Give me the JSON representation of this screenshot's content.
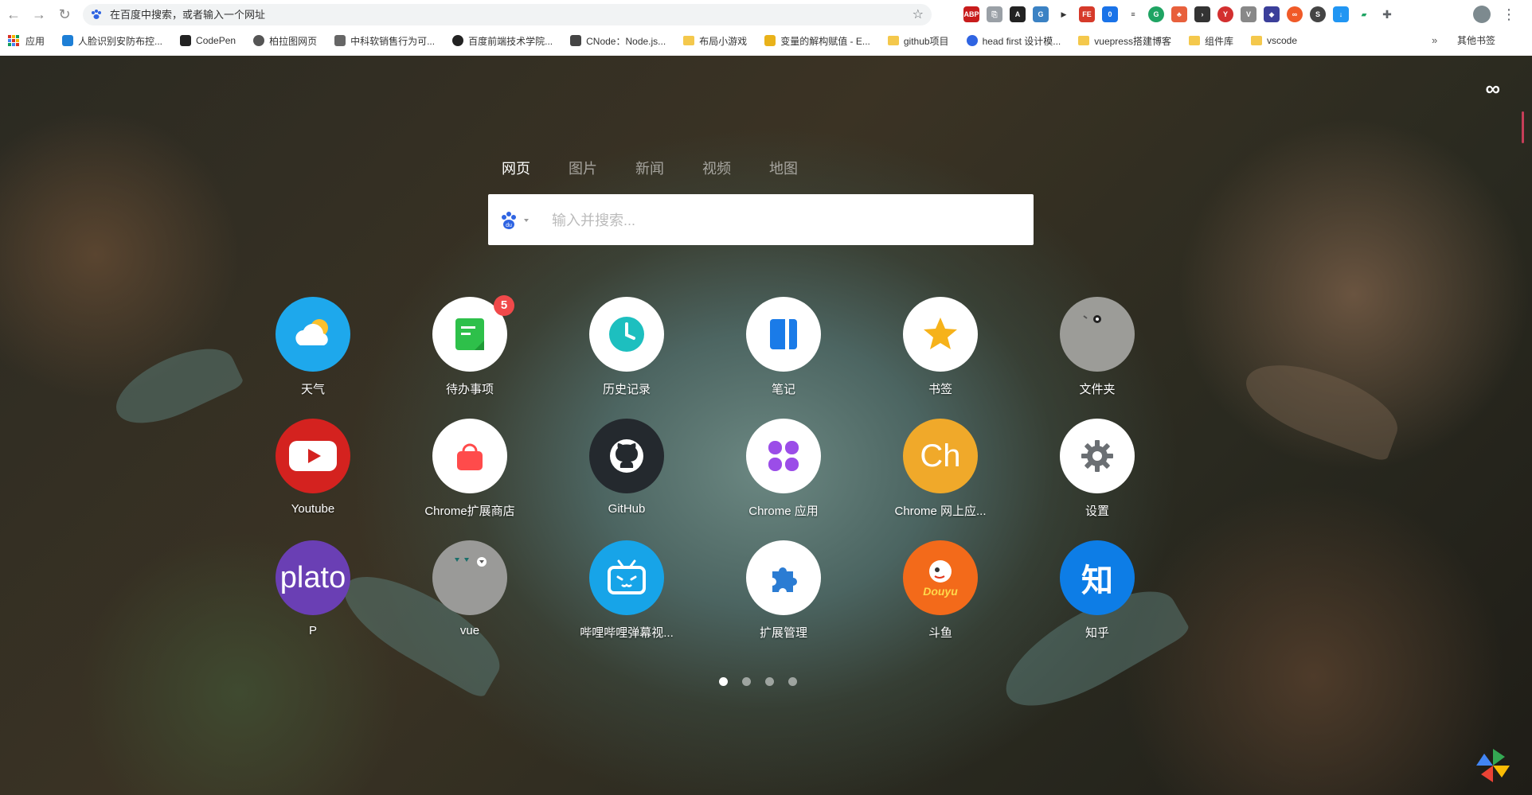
{
  "browser": {
    "omnibox_text": "在百度中搜索，或者输入一个网址",
    "bookmarks": [
      {
        "label": "应用",
        "icon": "apps-icon"
      },
      {
        "label": "人脸识别安防布控...",
        "icon": "edge-icon"
      },
      {
        "label": "CodePen",
        "icon": "codepen-icon"
      },
      {
        "label": "柏拉图网页",
        "icon": "globe-icon"
      },
      {
        "label": "中科软销售行为可...",
        "icon": "page-icon"
      },
      {
        "label": "百度前端技术学院...",
        "icon": "baidu-fe-icon"
      },
      {
        "label": "CNode：Node.js...",
        "icon": "cnode-icon"
      },
      {
        "label": "布局小游戏",
        "icon": "folder-icon"
      },
      {
        "label": "变量的解构赋值 - E...",
        "icon": "es-icon"
      },
      {
        "label": "github项目",
        "icon": "folder-icon"
      },
      {
        "label": "head first 设计模...",
        "icon": "paw-icon"
      },
      {
        "label": "vuepress搭建博客",
        "icon": "folder-icon"
      },
      {
        "label": "组件库",
        "icon": "folder-icon"
      },
      {
        "label": "vscode",
        "icon": "folder-icon"
      }
    ],
    "more": "»",
    "other_bookmarks": "其他书签"
  },
  "newtab": {
    "tabs": [
      "网页",
      "图片",
      "新闻",
      "视频",
      "地图"
    ],
    "active_tab": 0,
    "search_placeholder": "输入并搜索...",
    "engine": "baidu-icon",
    "apps": [
      {
        "label": "天气",
        "icon": "weather-icon",
        "bg": "#1ea8ec"
      },
      {
        "label": "待办事项",
        "icon": "todo-icon",
        "bg": "#ffffff",
        "badge": "5"
      },
      {
        "label": "历史记录",
        "icon": "history-icon",
        "bg": "#ffffff"
      },
      {
        "label": "笔记",
        "icon": "notes-icon",
        "bg": "#ffffff"
      },
      {
        "label": "书签",
        "icon": "bookmark-star-icon",
        "bg": "#ffffff"
      },
      {
        "label": "文件夹",
        "icon": "folder-icon",
        "bg": "#9c9c98"
      },
      {
        "label": "Youtube",
        "icon": "youtube-icon",
        "bg": "#d4221f"
      },
      {
        "label": "Chrome扩展商店",
        "icon": "chrome-store-icon",
        "bg": "#ffffff"
      },
      {
        "label": "GitHub",
        "icon": "github-icon",
        "bg": "#24292e"
      },
      {
        "label": "Chrome 应用",
        "icon": "chrome-apps-icon",
        "bg": "#ffffff"
      },
      {
        "label": "Chrome 网上应...",
        "icon": "chrome-webstore-icon",
        "bg": "#f0a92a",
        "text": "Ch"
      },
      {
        "label": "设置",
        "icon": "settings-icon",
        "bg": "#ffffff"
      },
      {
        "label": "P",
        "icon": "plato-icon",
        "bg": "#6a3fb4",
        "text": "plato"
      },
      {
        "label": "vue",
        "icon": "vue-icon",
        "bg": "#9a9a98"
      },
      {
        "label": "哔哩哔哩弹幕视...",
        "icon": "bilibili-icon",
        "bg": "#17a4e8"
      },
      {
        "label": "扩展管理",
        "icon": "extensions-icon",
        "bg": "#ffffff"
      },
      {
        "label": "斗鱼",
        "icon": "douyu-icon",
        "bg": "#f36a1a",
        "text": "Douyu"
      },
      {
        "label": "知乎",
        "icon": "zhihu-icon",
        "bg": "#0d7de6",
        "text": "知"
      }
    ],
    "page_count": 4,
    "active_page": 0
  }
}
